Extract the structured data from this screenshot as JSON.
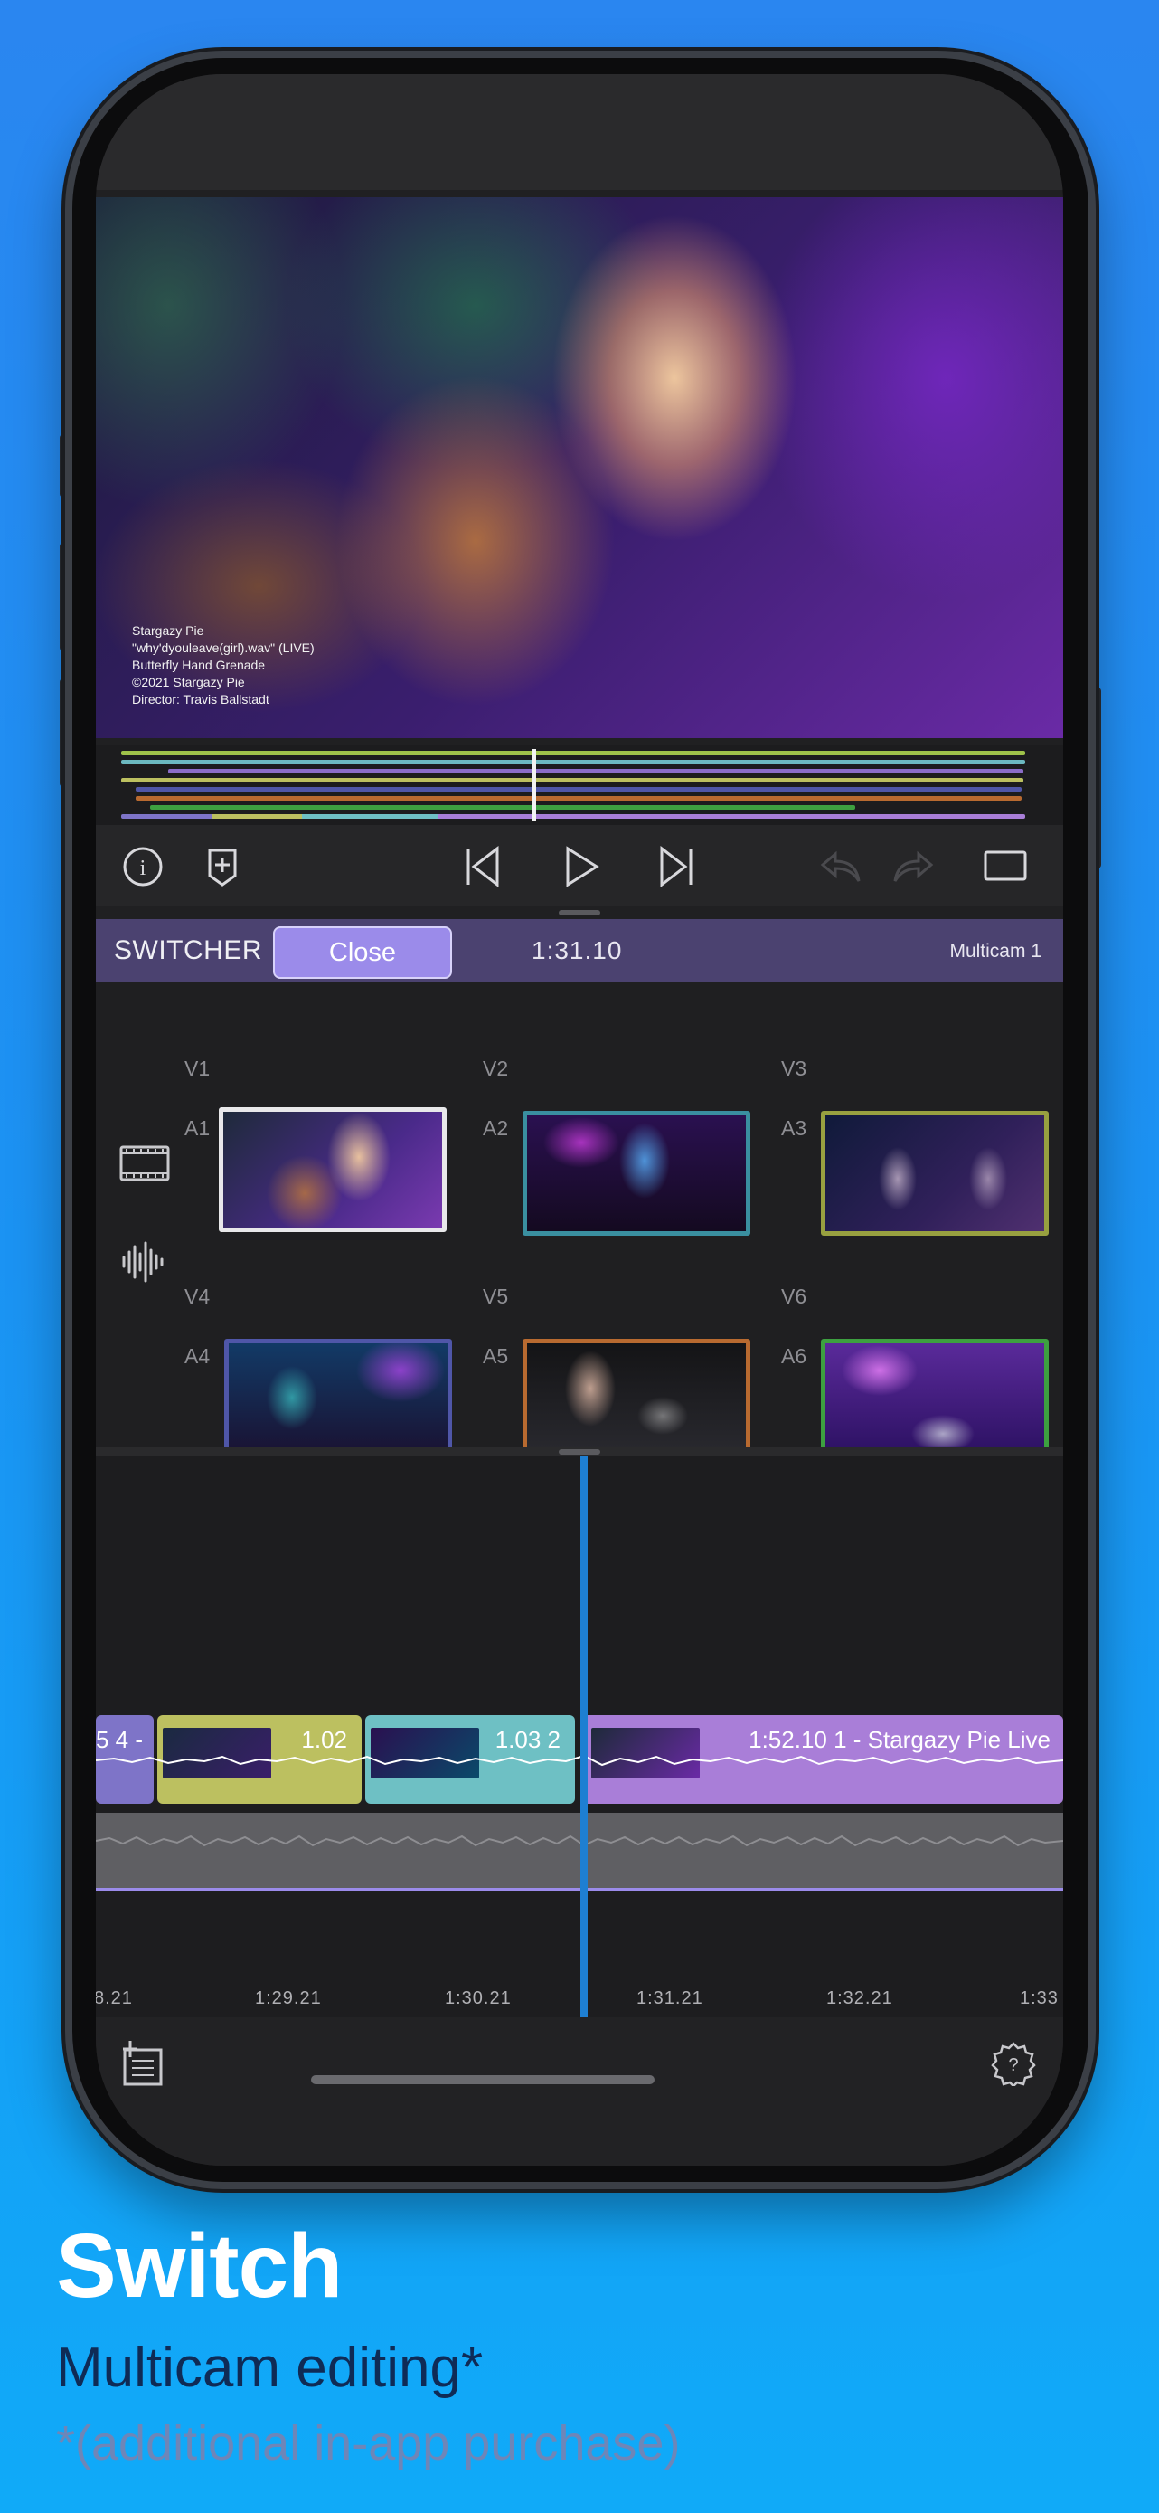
{
  "preview": {
    "credits": [
      "Stargazy Pie",
      "\"why'dyouleave(girl).wav\" (LIVE)",
      "Butterfly Hand Grenade",
      "©2021 Stargazy Pie",
      "Director: Travis Ballstadt"
    ]
  },
  "switcher": {
    "title": "SWITCHER",
    "close_label": "Close",
    "timecode": "1:31.10",
    "multicam_name": "Multicam 1",
    "angles": [
      {
        "video": "V1",
        "audio": "A1",
        "color": "#e8e8ea"
      },
      {
        "video": "V2",
        "audio": "A2",
        "color": "#3a8fa0"
      },
      {
        "video": "V3",
        "audio": "A3",
        "color": "#98a040"
      },
      {
        "video": "V4",
        "audio": "A4",
        "color": "#4f56a8"
      },
      {
        "video": "V5",
        "audio": "A5",
        "color": "#b86a30"
      },
      {
        "video": "V6",
        "audio": "A6",
        "color": "#3da040"
      }
    ]
  },
  "timeline": {
    "clips": [
      {
        "label": "5  4 -",
        "color": "#7e74c8"
      },
      {
        "label": "1.02",
        "color": "#bcc060"
      },
      {
        "label": "1.03   2",
        "color": "#6ec0c4"
      },
      {
        "label": "1:52.10   1 - Stargazy Pie Live",
        "color": "#a97ed8"
      }
    ],
    "ruler": [
      "8.21",
      "1:29.21",
      "1:30.21",
      "1:31.21",
      "1:32.21",
      "1:33"
    ]
  },
  "marketing": {
    "headline": "Switch",
    "subhead": "Multicam editing*",
    "footnote": "*(additional in-app purchase)"
  },
  "icons": [
    "info-icon",
    "add-marker-icon",
    "skip-back-icon",
    "play-icon",
    "skip-forward-icon",
    "undo-icon",
    "redo-icon",
    "aspect-icon",
    "video-track-icon",
    "audio-track-icon",
    "add-title-icon",
    "settings-icon"
  ]
}
